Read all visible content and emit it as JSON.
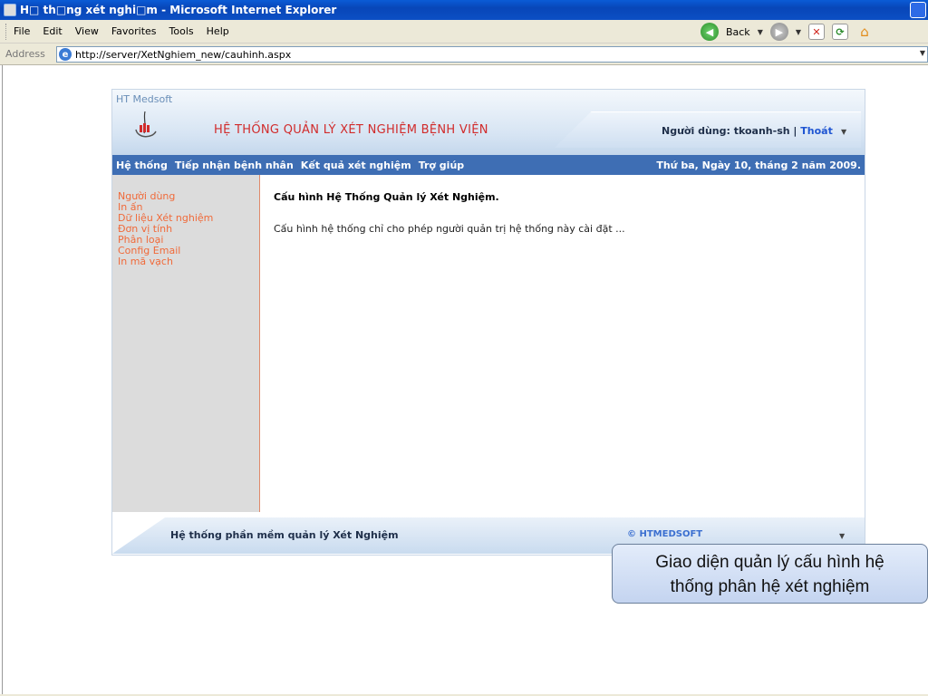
{
  "window": {
    "title": "H□ th□ng xét nghi□m - Microsoft Internet Explorer"
  },
  "menu": {
    "items": [
      "File",
      "Edit",
      "View",
      "Favorites",
      "Tools",
      "Help"
    ]
  },
  "toolbar": {
    "back_label": "Back"
  },
  "address": {
    "label": "Address",
    "url": "http://server/XetNghiem_new/cauhinh.aspx"
  },
  "app": {
    "company": "HT Medsoft",
    "title": "HỆ THỐNG QUẢN LÝ XÉT NGHIỆM BỆNH VIỆN",
    "user_label": "Người dùng: tkoanh-sh | ",
    "logout": "Thoát",
    "nav": [
      "Hệ thống",
      "Tiếp nhận bệnh nhân",
      "Kết quả xét nghiệm",
      "Trợ giúp"
    ],
    "date": "Thứ ba, Ngày 10, tháng 2 năm 2009.",
    "sidebar": [
      "Người dùng",
      "In ấn",
      "Dữ liệu Xét nghiệm",
      "Đơn vị tính",
      "Phân loại",
      "Config Email",
      "In mã vạch"
    ],
    "main_heading": "Cấu hình Hệ Thống Quản lý Xét Nghiệm.",
    "main_text": "Cấu hình hệ thống chỉ cho phép người quản trị hệ thống này cài đặt ...",
    "footer_text": "Hệ thống phần mềm quản lý Xét Nghiệm",
    "copyright": "© HTMEDSOFT"
  },
  "caption": {
    "line1": "Giao diện quản lý cấu hình hệ",
    "line2": "thống phân hệ xét nghiệm"
  },
  "colors": {
    "nav_bar": "#3e6eb4",
    "sidebar_link": "#f06a3a",
    "title_red": "#d12b2b"
  }
}
